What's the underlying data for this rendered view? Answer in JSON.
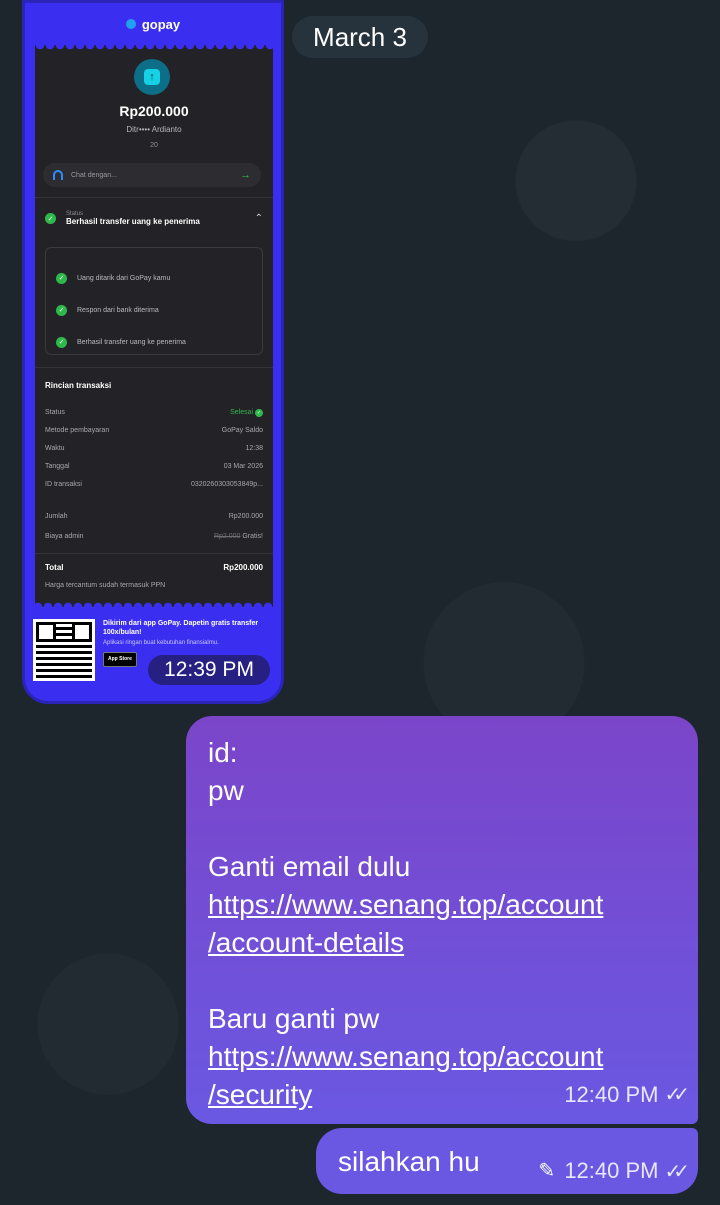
{
  "date_divider": "March 3",
  "image_message": {
    "time": "12:39 PM",
    "receipt": {
      "brand": "gopay",
      "amount": "Rp200.000",
      "recipient": "Ditr•••• Ardianto",
      "recipient_sub": "20",
      "chat_label": "Chat dengan...",
      "status_label": "Status",
      "status_value": "Berhasil transfer uang ke penerima",
      "steps": [
        "Uang ditarik dari GoPay kamu",
        "Respon dari bank diterima",
        "Berhasil transfer uang ke penerima"
      ],
      "details_title": "Rincian transaksi",
      "details": [
        {
          "label": "Status",
          "value": "Selesai"
        },
        {
          "label": "Metode pembayaran",
          "value": "GoPay Saldo"
        },
        {
          "label": "Waktu",
          "value": "12:38"
        },
        {
          "label": "Tanggal",
          "value": "03 Mar 2026"
        },
        {
          "label": "ID transaksi",
          "value": "0320260303053849p..."
        }
      ],
      "jumlah_label": "Jumlah",
      "jumlah_value": "Rp200.000",
      "admin_label": "Biaya admin",
      "admin_old": "Rp2.000",
      "admin_value": "Gratis!",
      "total_label": "Total",
      "total_value": "Rp200.000",
      "ppn_note": "Harga tercantum sudah termasuk PPN",
      "promo_text": "Dikirim dari app GoPay. Dapetin gratis transfer 100x/bulan!",
      "promo_sub": "Aplikasi ringan buat kebutuhan finansialmu.",
      "appstore_label": "App Store"
    }
  },
  "outgoing_message_1": {
    "lines": {
      "id": "id:",
      "pw": "pw",
      "ganti_email": "Ganti email dulu",
      "link1_a": "https://www.senang.top/account",
      "link1_b": "/account-details",
      "baru_ganti": "Baru ganti pw",
      "link2_a": "https://www.senang.top/account",
      "link2_b": "/security"
    },
    "time": "12:40 PM"
  },
  "outgoing_message_2": {
    "text": "silahkan hu",
    "time": "12:40 PM"
  },
  "icons": {
    "edited": "pencil-icon",
    "read": "double-check-icon"
  },
  "colors": {
    "background": "#1d252d",
    "outgoing_bubble": "#6a58e2",
    "gopay_blue": "#3a2ff0",
    "success_green": "#2fb84a"
  }
}
